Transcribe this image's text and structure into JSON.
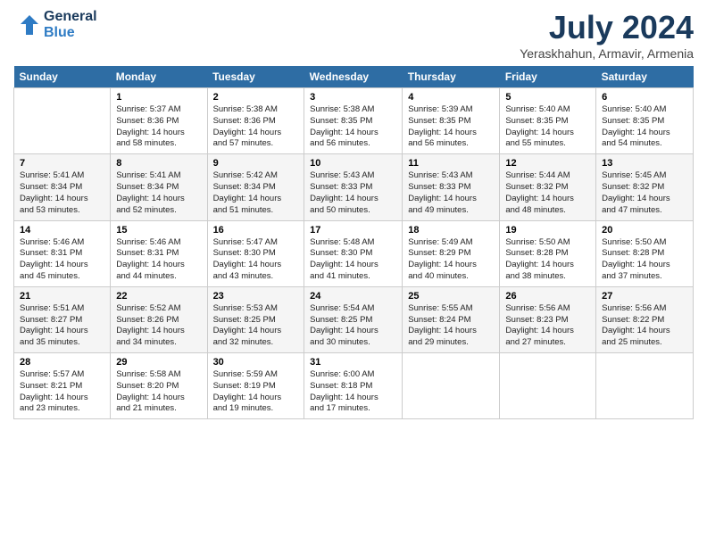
{
  "logo": {
    "line1": "General",
    "line2": "Blue"
  },
  "title": "July 2024",
  "subtitle": "Yeraskhahun, Armavir, Armenia",
  "days_header": [
    "Sunday",
    "Monday",
    "Tuesday",
    "Wednesday",
    "Thursday",
    "Friday",
    "Saturday"
  ],
  "weeks": [
    [
      {
        "num": "",
        "text": ""
      },
      {
        "num": "1",
        "text": "Sunrise: 5:37 AM\nSunset: 8:36 PM\nDaylight: 14 hours\nand 58 minutes."
      },
      {
        "num": "2",
        "text": "Sunrise: 5:38 AM\nSunset: 8:36 PM\nDaylight: 14 hours\nand 57 minutes."
      },
      {
        "num": "3",
        "text": "Sunrise: 5:38 AM\nSunset: 8:35 PM\nDaylight: 14 hours\nand 56 minutes."
      },
      {
        "num": "4",
        "text": "Sunrise: 5:39 AM\nSunset: 8:35 PM\nDaylight: 14 hours\nand 56 minutes."
      },
      {
        "num": "5",
        "text": "Sunrise: 5:40 AM\nSunset: 8:35 PM\nDaylight: 14 hours\nand 55 minutes."
      },
      {
        "num": "6",
        "text": "Sunrise: 5:40 AM\nSunset: 8:35 PM\nDaylight: 14 hours\nand 54 minutes."
      }
    ],
    [
      {
        "num": "7",
        "text": "Sunrise: 5:41 AM\nSunset: 8:34 PM\nDaylight: 14 hours\nand 53 minutes."
      },
      {
        "num": "8",
        "text": "Sunrise: 5:41 AM\nSunset: 8:34 PM\nDaylight: 14 hours\nand 52 minutes."
      },
      {
        "num": "9",
        "text": "Sunrise: 5:42 AM\nSunset: 8:34 PM\nDaylight: 14 hours\nand 51 minutes."
      },
      {
        "num": "10",
        "text": "Sunrise: 5:43 AM\nSunset: 8:33 PM\nDaylight: 14 hours\nand 50 minutes."
      },
      {
        "num": "11",
        "text": "Sunrise: 5:43 AM\nSunset: 8:33 PM\nDaylight: 14 hours\nand 49 minutes."
      },
      {
        "num": "12",
        "text": "Sunrise: 5:44 AM\nSunset: 8:32 PM\nDaylight: 14 hours\nand 48 minutes."
      },
      {
        "num": "13",
        "text": "Sunrise: 5:45 AM\nSunset: 8:32 PM\nDaylight: 14 hours\nand 47 minutes."
      }
    ],
    [
      {
        "num": "14",
        "text": "Sunrise: 5:46 AM\nSunset: 8:31 PM\nDaylight: 14 hours\nand 45 minutes."
      },
      {
        "num": "15",
        "text": "Sunrise: 5:46 AM\nSunset: 8:31 PM\nDaylight: 14 hours\nand 44 minutes."
      },
      {
        "num": "16",
        "text": "Sunrise: 5:47 AM\nSunset: 8:30 PM\nDaylight: 14 hours\nand 43 minutes."
      },
      {
        "num": "17",
        "text": "Sunrise: 5:48 AM\nSunset: 8:30 PM\nDaylight: 14 hours\nand 41 minutes."
      },
      {
        "num": "18",
        "text": "Sunrise: 5:49 AM\nSunset: 8:29 PM\nDaylight: 14 hours\nand 40 minutes."
      },
      {
        "num": "19",
        "text": "Sunrise: 5:50 AM\nSunset: 8:28 PM\nDaylight: 14 hours\nand 38 minutes."
      },
      {
        "num": "20",
        "text": "Sunrise: 5:50 AM\nSunset: 8:28 PM\nDaylight: 14 hours\nand 37 minutes."
      }
    ],
    [
      {
        "num": "21",
        "text": "Sunrise: 5:51 AM\nSunset: 8:27 PM\nDaylight: 14 hours\nand 35 minutes."
      },
      {
        "num": "22",
        "text": "Sunrise: 5:52 AM\nSunset: 8:26 PM\nDaylight: 14 hours\nand 34 minutes."
      },
      {
        "num": "23",
        "text": "Sunrise: 5:53 AM\nSunset: 8:25 PM\nDaylight: 14 hours\nand 32 minutes."
      },
      {
        "num": "24",
        "text": "Sunrise: 5:54 AM\nSunset: 8:25 PM\nDaylight: 14 hours\nand 30 minutes."
      },
      {
        "num": "25",
        "text": "Sunrise: 5:55 AM\nSunset: 8:24 PM\nDaylight: 14 hours\nand 29 minutes."
      },
      {
        "num": "26",
        "text": "Sunrise: 5:56 AM\nSunset: 8:23 PM\nDaylight: 14 hours\nand 27 minutes."
      },
      {
        "num": "27",
        "text": "Sunrise: 5:56 AM\nSunset: 8:22 PM\nDaylight: 14 hours\nand 25 minutes."
      }
    ],
    [
      {
        "num": "28",
        "text": "Sunrise: 5:57 AM\nSunset: 8:21 PM\nDaylight: 14 hours\nand 23 minutes."
      },
      {
        "num": "29",
        "text": "Sunrise: 5:58 AM\nSunset: 8:20 PM\nDaylight: 14 hours\nand 21 minutes."
      },
      {
        "num": "30",
        "text": "Sunrise: 5:59 AM\nSunset: 8:19 PM\nDaylight: 14 hours\nand 19 minutes."
      },
      {
        "num": "31",
        "text": "Sunrise: 6:00 AM\nSunset: 8:18 PM\nDaylight: 14 hours\nand 17 minutes."
      },
      {
        "num": "",
        "text": ""
      },
      {
        "num": "",
        "text": ""
      },
      {
        "num": "",
        "text": ""
      }
    ]
  ]
}
